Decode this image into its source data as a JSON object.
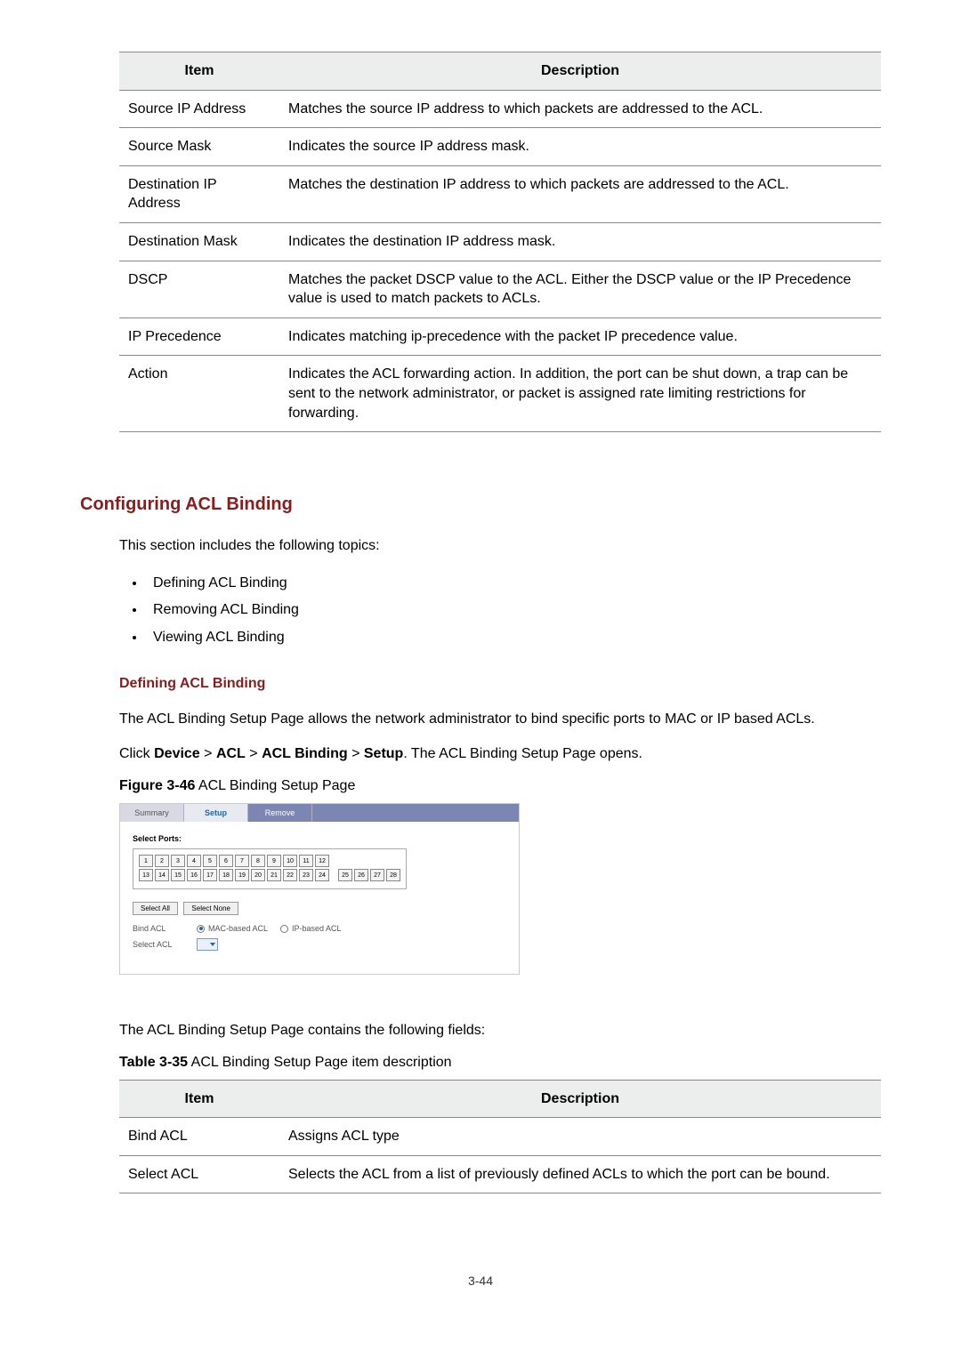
{
  "table1": {
    "headers": {
      "item": "Item",
      "desc": "Description"
    },
    "rows": [
      {
        "item": "Source IP Address",
        "desc": "Matches the source IP address to which packets are addressed to the ACL."
      },
      {
        "item": "Source Mask",
        "desc": "Indicates the source IP address mask."
      },
      {
        "item": "Destination IP Address",
        "desc": "Matches the destination IP address to which packets are addressed to the ACL."
      },
      {
        "item": "Destination Mask",
        "desc": "Indicates the destination IP address mask."
      },
      {
        "item": "DSCP",
        "desc": "Matches the packet DSCP value to the ACL. Either the DSCP value or the IP Precedence value is used to match packets to ACLs."
      },
      {
        "item": "IP Precedence",
        "desc": "Indicates matching ip-precedence with the packet IP precedence value."
      },
      {
        "item": "Action",
        "desc": "Indicates the ACL forwarding action. In addition, the port can be shut down, a trap can be sent to the network administrator, or packet is assigned rate limiting restrictions for forwarding."
      }
    ]
  },
  "section_heading": "Configuring ACL Binding",
  "intro": "This section includes the following topics:",
  "topics": [
    "Defining ACL Binding",
    "Removing ACL Binding",
    "Viewing ACL Binding"
  ],
  "sub_heading": "Defining ACL Binding",
  "para1": "The ACL Binding Setup Page allows the network administrator to bind specific ports to MAC or IP based ACLs.",
  "click_prefix": "Click ",
  "breadcrumb": [
    "Device",
    "ACL",
    "ACL Binding",
    "Setup"
  ],
  "click_suffix": ". The ACL Binding Setup Page opens.",
  "figure_label": "Figure 3-46",
  "figure_caption": " ACL Binding Setup Page",
  "shot": {
    "tabs": {
      "summary": "Summary",
      "setup": "Setup",
      "remove": "Remove"
    },
    "select_ports": "Select Ports:",
    "ports_row1": [
      "1",
      "2",
      "3",
      "4",
      "5",
      "6",
      "7",
      "8",
      "9",
      "10",
      "11",
      "12"
    ],
    "ports_row2": [
      "13",
      "14",
      "15",
      "16",
      "17",
      "18",
      "19",
      "20",
      "21",
      "22",
      "23",
      "24"
    ],
    "ports_row2b": [
      "25",
      "26",
      "27",
      "28"
    ],
    "select_all": "Select All",
    "select_none": "Select None",
    "bind_acl_label": "Bind ACL",
    "radio_mac": "MAC-based ACL",
    "radio_ip": "IP-based ACL",
    "select_acl_label": "Select ACL"
  },
  "para2": "The ACL Binding Setup Page contains the following fields:",
  "table2_label": "Table 3-35",
  "table2_caption": " ACL Binding Setup Page item description",
  "table2": {
    "headers": {
      "item": "Item",
      "desc": "Description"
    },
    "rows": [
      {
        "item": "Bind ACL",
        "desc": "Assigns ACL type"
      },
      {
        "item": "Select ACL",
        "desc": "Selects the ACL from a list of previously defined ACLs to which the port can be bound."
      }
    ]
  },
  "page_number": "3-44"
}
